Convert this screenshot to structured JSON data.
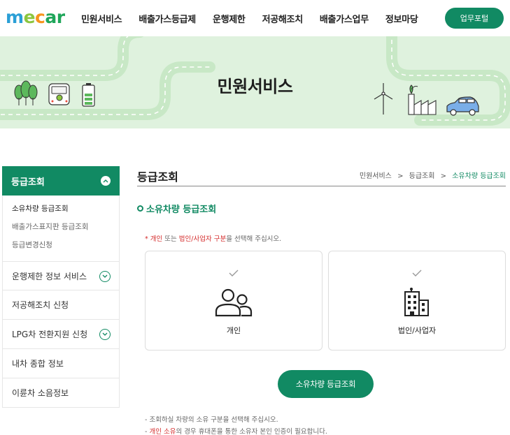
{
  "header": {
    "logo_text": "mecar",
    "logo_letters": [
      {
        "ch": "m",
        "color": "#2a9fd6"
      },
      {
        "ch": "e",
        "color": "#8cc63f"
      },
      {
        "ch": "c",
        "color": "#f7941d"
      },
      {
        "ch": "a",
        "color": "#1fa65a"
      },
      {
        "ch": "r",
        "color": "#1fa65a"
      }
    ],
    "nav": [
      "민원서비스",
      "배출가스등급제",
      "운행제한",
      "저공해조치",
      "배출가스업무",
      "정보마당"
    ],
    "portal_button": "업무포털"
  },
  "banner": {
    "title": "민원서비스"
  },
  "sidebar": {
    "head": "등급조회",
    "sub_items": [
      "소유차량 등급조회",
      "배출가스표지판 등급조회",
      "등급변경신청"
    ],
    "items": [
      {
        "label": "운행제한 정보 서비스",
        "expandable": true
      },
      {
        "label": "저공해조치 신청",
        "expandable": false
      },
      {
        "label": "LPG차 전환지원 신청",
        "expandable": true
      },
      {
        "label": "내차 종합 정보",
        "expandable": false
      },
      {
        "label": "이륜차 소음정보",
        "expandable": false
      }
    ]
  },
  "main": {
    "title": "등급조회",
    "breadcrumb": [
      "민원서비스",
      "등급조회",
      "소유차량 등급조회"
    ],
    "breadcrumb_sep": ">",
    "section_title": "소유차량 등급조회",
    "notice": {
      "star": "* ",
      "part1": "개인",
      "part2": " 또는 ",
      "part3": "법인/사업자 구분",
      "part4": "을 선택해 주십시오."
    },
    "options": [
      "개인",
      "법인/사업자"
    ],
    "submit_button": "소유차량 등급조회",
    "notes": {
      "line1": "- 조회하실 차량의 소유 구분을 선택해 주십시오.",
      "line2_prefix": "- ",
      "line2_red": "개인 소유",
      "line2_rest": "의 경우 휴대폰을 통한 소유자 본인 인증이 필요합니다."
    }
  },
  "colors": {
    "brand_green": "#118a63",
    "banner_bg": "#dff2de",
    "road": "#c8e8c6",
    "notice_red": "#d42b2b"
  }
}
